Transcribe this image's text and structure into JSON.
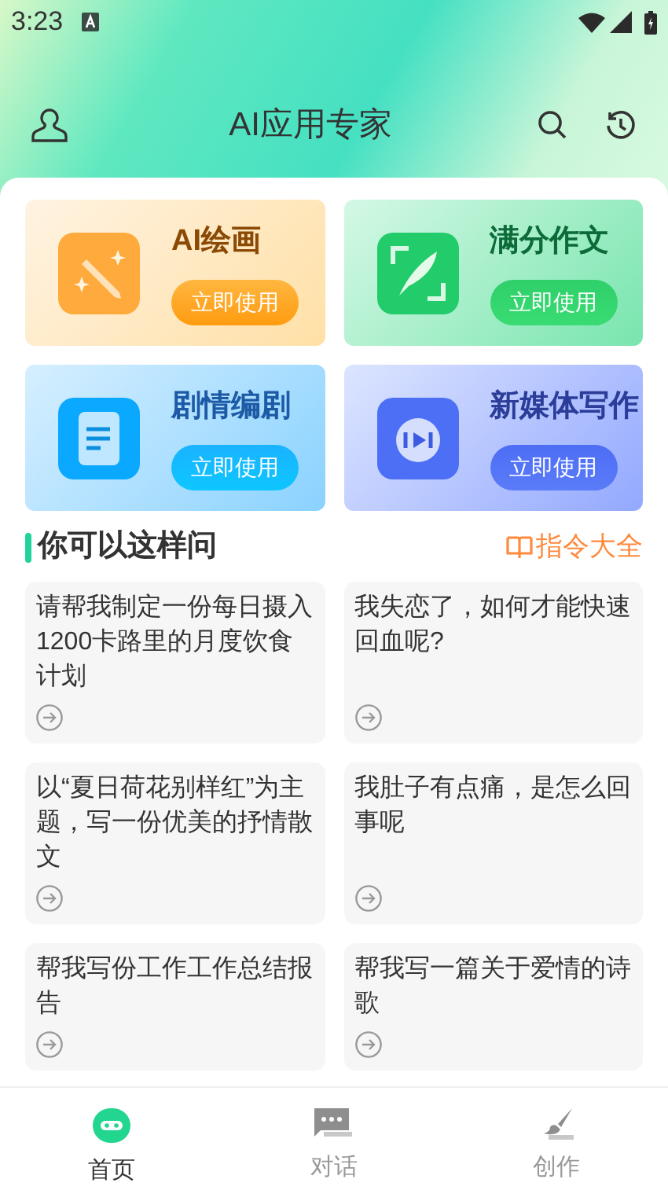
{
  "status_bar": {
    "time": "3:23"
  },
  "header": {
    "title": "AI应用专家"
  },
  "features": [
    {
      "title": "AI绘画",
      "button": "立即使用",
      "kind": "paint"
    },
    {
      "title": "满分作文",
      "button": "立即使用",
      "kind": "essay"
    },
    {
      "title": "剧情编剧",
      "button": "立即使用",
      "kind": "script"
    },
    {
      "title": "新媒体写作",
      "button": "立即使用",
      "kind": "media"
    }
  ],
  "section": {
    "title": "你可以这样问",
    "link": "指令大全"
  },
  "prompts": [
    {
      "text": "请帮我制定一份每日摄入1200卡路里的月度饮食计划"
    },
    {
      "text": "我失恋了，如何才能快速回血呢?"
    },
    {
      "text": "以“夏日荷花别样红”为主题，写一份优美的抒情散文"
    },
    {
      "text": "我肚子有点痛，是怎么回事呢"
    },
    {
      "text": "帮我写份工作工作总结报告"
    },
    {
      "text": "帮我写一篇关于爱情的诗歌"
    }
  ],
  "tabs": [
    {
      "label": "首页",
      "selected": true,
      "kind": "home"
    },
    {
      "label": "对话",
      "selected": false,
      "kind": "chat"
    },
    {
      "label": "创作",
      "selected": false,
      "kind": "create"
    }
  ]
}
